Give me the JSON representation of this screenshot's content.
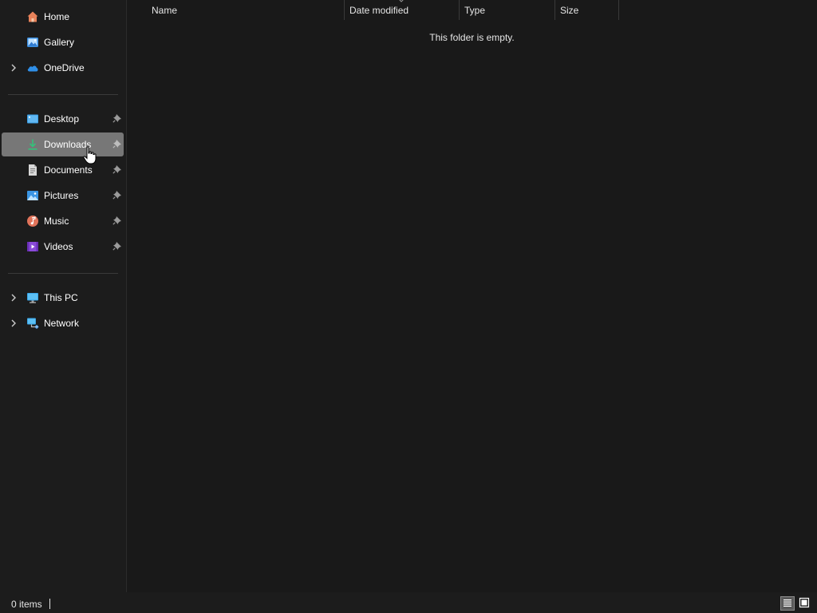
{
  "sidebar": {
    "quick": [
      {
        "label": "Home",
        "icon": "home-icon"
      },
      {
        "label": "Gallery",
        "icon": "gallery-icon"
      },
      {
        "label": "OneDrive",
        "icon": "onedrive-icon"
      }
    ],
    "pinned": [
      {
        "label": "Desktop",
        "icon": "desktop-icon"
      },
      {
        "label": "Downloads",
        "icon": "downloads-icon",
        "selected": true
      },
      {
        "label": "Documents",
        "icon": "documents-icon"
      },
      {
        "label": "Pictures",
        "icon": "pictures-icon"
      },
      {
        "label": "Music",
        "icon": "music-icon"
      },
      {
        "label": "Videos",
        "icon": "videos-icon"
      }
    ],
    "locations": [
      {
        "label": "This PC",
        "icon": "this-pc-icon"
      },
      {
        "label": "Network",
        "icon": "network-icon"
      }
    ]
  },
  "columns": [
    "Name",
    "Date modified",
    "Type",
    "Size"
  ],
  "sorted_column": "Date modified",
  "empty_message": "This folder is empty.",
  "status": {
    "item_count": "0 items",
    "active_view": "details"
  },
  "colors": {
    "background": "#191919",
    "selected": "#777777",
    "text": "#ffffff"
  }
}
